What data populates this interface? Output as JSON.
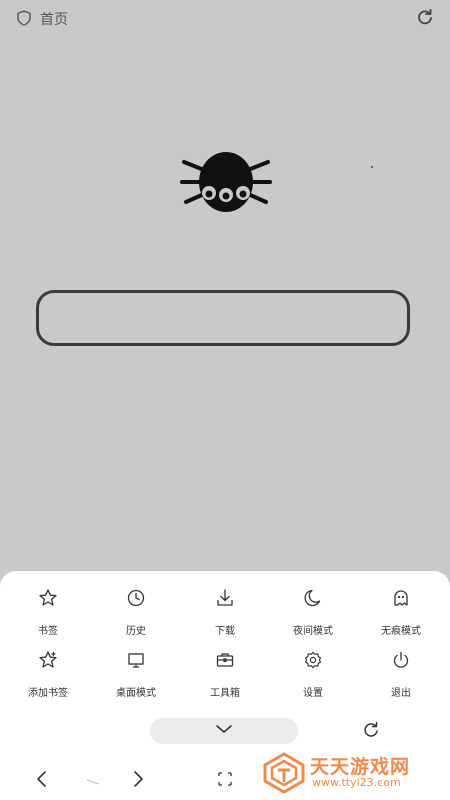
{
  "header": {
    "title": "首页",
    "shield_icon": "shield-icon",
    "refresh_icon": "refresh-icon"
  },
  "logo": {
    "icon": "spider-logo"
  },
  "search": {
    "placeholder": ""
  },
  "menu": {
    "row1": [
      {
        "icon": "star-icon",
        "label": "书签"
      },
      {
        "icon": "clock-icon",
        "label": "历史"
      },
      {
        "icon": "download-icon",
        "label": "下载"
      },
      {
        "icon": "moon-icon",
        "label": "夜间模式"
      },
      {
        "icon": "ghost-icon",
        "label": "无痕模式"
      }
    ],
    "row2": [
      {
        "icon": "star-plus-icon",
        "label": "添加书签"
      },
      {
        "icon": "monitor-icon",
        "label": "桌面模式"
      },
      {
        "icon": "toolbox-icon",
        "label": "工具箱"
      },
      {
        "icon": "gear-icon",
        "label": "设置"
      },
      {
        "icon": "power-icon",
        "label": "退出"
      }
    ]
  },
  "bottom_bar": {
    "collapse_icon": "chevron-down-icon",
    "reload_icon": "reload-icon",
    "back_icon": "chevron-left-icon",
    "forward_icon": "chevron-right-icon",
    "tabs_icon": "tabs-icon"
  },
  "watermark": {
    "name": "天天游戏网",
    "url": "www.ttyl23.com"
  },
  "colors": {
    "page_bg": "#c9c9c9",
    "sheet_bg": "#ffffff",
    "watermark": "#f08a4b"
  }
}
